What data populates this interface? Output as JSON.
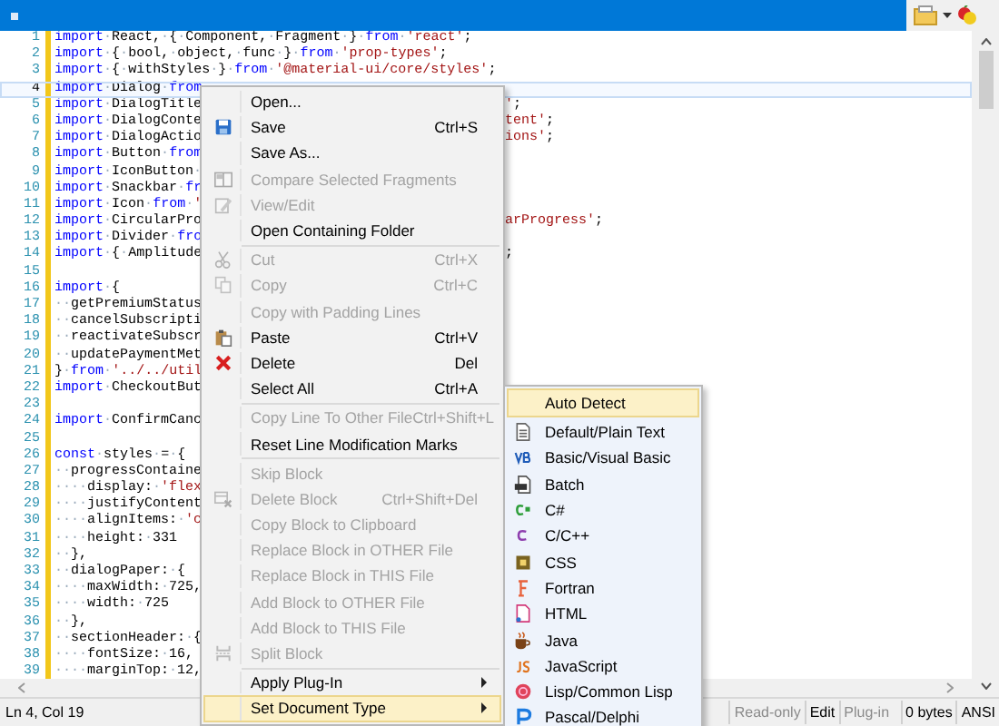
{
  "code_lines": [
    {
      "number": "1",
      "selected": false,
      "tokens": [
        {
          "kind": "keyword",
          "text": "import"
        },
        {
          "kind": "plain",
          "text": "·React,·{·Component,·Fragment·}·"
        },
        {
          "kind": "keyword",
          "text": "from"
        },
        {
          "kind": "plain",
          "text": "·"
        },
        {
          "kind": "string",
          "text": "'react'"
        },
        {
          "kind": "plain",
          "text": ";"
        }
      ]
    },
    {
      "number": "2",
      "selected": false,
      "tokens": [
        {
          "kind": "keyword",
          "text": "import"
        },
        {
          "kind": "plain",
          "text": "·{·bool,·object,·func·}·"
        },
        {
          "kind": "keyword",
          "text": "from"
        },
        {
          "kind": "plain",
          "text": "·"
        },
        {
          "kind": "string",
          "text": "'prop-types'"
        },
        {
          "kind": "plain",
          "text": ";"
        }
      ]
    },
    {
      "number": "3",
      "selected": false,
      "tokens": [
        {
          "kind": "keyword",
          "text": "import"
        },
        {
          "kind": "plain",
          "text": "·{·withStyles·}·"
        },
        {
          "kind": "keyword",
          "text": "from"
        },
        {
          "kind": "plain",
          "text": "·"
        },
        {
          "kind": "string",
          "text": "'@material-ui/core/styles'"
        },
        {
          "kind": "plain",
          "text": ";"
        }
      ]
    },
    {
      "number": "4",
      "selected": true,
      "tokens": [
        {
          "kind": "keyword",
          "text": "import"
        },
        {
          "kind": "plain",
          "text": "·Dialog·"
        },
        {
          "kind": "keyword",
          "text": "from"
        }
      ]
    },
    {
      "number": "5",
      "selected": false,
      "tokens": [
        {
          "kind": "keyword",
          "text": "import"
        },
        {
          "kind": "plain",
          "text": "·DialogTitle"
        }
      ],
      "tail": [
        {
          "kind": "string",
          "text": "'"
        },
        {
          "kind": "plain",
          "text": ";"
        }
      ]
    },
    {
      "number": "6",
      "selected": false,
      "tokens": [
        {
          "kind": "keyword",
          "text": "import"
        },
        {
          "kind": "plain",
          "text": "·DialogConte"
        }
      ],
      "tail": [
        {
          "kind": "string",
          "text": "tent'"
        },
        {
          "kind": "plain",
          "text": ";"
        }
      ]
    },
    {
      "number": "7",
      "selected": false,
      "tokens": [
        {
          "kind": "keyword",
          "text": "import"
        },
        {
          "kind": "plain",
          "text": "·DialogActio"
        }
      ],
      "tail": [
        {
          "kind": "string",
          "text": "ions'"
        },
        {
          "kind": "plain",
          "text": ";"
        }
      ]
    },
    {
      "number": "8",
      "selected": false,
      "tokens": [
        {
          "kind": "keyword",
          "text": "import"
        },
        {
          "kind": "plain",
          "text": "·Button·"
        },
        {
          "kind": "keyword",
          "text": "from"
        }
      ]
    },
    {
      "number": "9",
      "selected": false,
      "tokens": [
        {
          "kind": "keyword",
          "text": "import"
        },
        {
          "kind": "plain",
          "text": "·IconButton·"
        }
      ]
    },
    {
      "number": "10",
      "selected": false,
      "tokens": [
        {
          "kind": "keyword",
          "text": "import"
        },
        {
          "kind": "plain",
          "text": "·Snackbar·"
        },
        {
          "kind": "keyword",
          "text": "fr"
        }
      ]
    },
    {
      "number": "11",
      "selected": false,
      "tokens": [
        {
          "kind": "keyword",
          "text": "import"
        },
        {
          "kind": "plain",
          "text": "·Icon·"
        },
        {
          "kind": "keyword",
          "text": "from"
        },
        {
          "kind": "plain",
          "text": "·"
        },
        {
          "kind": "string",
          "text": "'"
        }
      ]
    },
    {
      "number": "12",
      "selected": false,
      "tokens": [
        {
          "kind": "keyword",
          "text": "import"
        },
        {
          "kind": "plain",
          "text": "·CircularPro"
        }
      ],
      "tail": [
        {
          "kind": "string",
          "text": "arProgress'"
        },
        {
          "kind": "plain",
          "text": ";"
        }
      ]
    },
    {
      "number": "13",
      "selected": false,
      "tokens": [
        {
          "kind": "keyword",
          "text": "import"
        },
        {
          "kind": "plain",
          "text": "·Divider·"
        },
        {
          "kind": "keyword",
          "text": "fro"
        }
      ]
    },
    {
      "number": "14",
      "selected": false,
      "tokens": [
        {
          "kind": "keyword",
          "text": "import"
        },
        {
          "kind": "plain",
          "text": "·{·Amplitude"
        }
      ],
      "tail": [
        {
          "kind": "plain",
          "text": ";"
        }
      ]
    },
    {
      "number": "15",
      "selected": false
    },
    {
      "number": "16",
      "selected": false,
      "tokens": [
        {
          "kind": "keyword",
          "text": "import"
        },
        {
          "kind": "plain",
          "text": "·{"
        }
      ]
    },
    {
      "number": "17",
      "selected": false,
      "tokens": [
        {
          "kind": "plain",
          "text": "··getPremiumStatus"
        }
      ]
    },
    {
      "number": "18",
      "selected": false,
      "tokens": [
        {
          "kind": "plain",
          "text": "··cancelSubscripti"
        }
      ]
    },
    {
      "number": "19",
      "selected": false,
      "tokens": [
        {
          "kind": "plain",
          "text": "··reactivateSubscr"
        }
      ]
    },
    {
      "number": "20",
      "selected": false,
      "tokens": [
        {
          "kind": "plain",
          "text": "··updatePaymentMet"
        }
      ]
    },
    {
      "number": "21",
      "selected": false,
      "tokens": [
        {
          "kind": "plain",
          "text": "}·"
        },
        {
          "kind": "keyword",
          "text": "from"
        },
        {
          "kind": "plain",
          "text": "·"
        },
        {
          "kind": "string",
          "text": "'../../util"
        }
      ]
    },
    {
      "number": "22",
      "selected": false,
      "tokens": [
        {
          "kind": "keyword",
          "text": "import"
        },
        {
          "kind": "plain",
          "text": "·CheckoutBut"
        }
      ]
    },
    {
      "number": "23",
      "selected": false
    },
    {
      "number": "24",
      "selected": false,
      "tokens": [
        {
          "kind": "keyword",
          "text": "import"
        },
        {
          "kind": "plain",
          "text": "·ConfirmCanc"
        }
      ]
    },
    {
      "number": "25",
      "selected": false
    },
    {
      "number": "26",
      "selected": false,
      "tokens": [
        {
          "kind": "keyword",
          "text": "const"
        },
        {
          "kind": "plain",
          "text": "·styles·=·{"
        }
      ]
    },
    {
      "number": "27",
      "selected": false,
      "tokens": [
        {
          "kind": "plain",
          "text": "··progressContaine"
        }
      ]
    },
    {
      "number": "28",
      "selected": false,
      "tokens": [
        {
          "kind": "plain",
          "text": "····display:·"
        },
        {
          "kind": "string",
          "text": "'flex"
        }
      ]
    },
    {
      "number": "29",
      "selected": false,
      "tokens": [
        {
          "kind": "plain",
          "text": "····justifyContent"
        }
      ]
    },
    {
      "number": "30",
      "selected": false,
      "tokens": [
        {
          "kind": "plain",
          "text": "····alignItems:·"
        },
        {
          "kind": "string",
          "text": "'c"
        }
      ]
    },
    {
      "number": "31",
      "selected": false,
      "tokens": [
        {
          "kind": "plain",
          "text": "····height:·331"
        }
      ]
    },
    {
      "number": "32",
      "selected": false,
      "tokens": [
        {
          "kind": "plain",
          "text": "··},"
        }
      ]
    },
    {
      "number": "33",
      "selected": false,
      "tokens": [
        {
          "kind": "plain",
          "text": "··dialogPaper:·{"
        }
      ]
    },
    {
      "number": "34",
      "selected": false,
      "tokens": [
        {
          "kind": "plain",
          "text": "····maxWidth:·725,"
        }
      ]
    },
    {
      "number": "35",
      "selected": false,
      "tokens": [
        {
          "kind": "plain",
          "text": "····width:·725"
        }
      ]
    },
    {
      "number": "36",
      "selected": false,
      "tokens": [
        {
          "kind": "plain",
          "text": "··},"
        }
      ]
    },
    {
      "number": "37",
      "selected": false,
      "tokens": [
        {
          "kind": "plain",
          "text": "··sectionHeader:·{"
        }
      ]
    },
    {
      "number": "38",
      "selected": false,
      "tokens": [
        {
          "kind": "plain",
          "text": "····fontSize:·16,"
        }
      ]
    },
    {
      "number": "39",
      "selected": false,
      "tokens": [
        {
          "kind": "plain",
          "text": "····marginTop:·12,"
        }
      ]
    }
  ],
  "context_menu": {
    "items": [
      {
        "kind": "item",
        "label": "Open...",
        "disabled": false,
        "selected": false
      },
      {
        "kind": "item",
        "label": "Save",
        "shortcut": "Ctrl+S",
        "disabled": false,
        "selected": false
      },
      {
        "kind": "item",
        "label": "Save As...",
        "disabled": false,
        "selected": false
      },
      {
        "kind": "item",
        "label": "Compare Selected Fragments",
        "disabled": true,
        "selected": false
      },
      {
        "kind": "item",
        "label": "View/Edit",
        "disabled": true,
        "selected": false
      },
      {
        "kind": "item",
        "label": "Open Containing Folder",
        "disabled": false,
        "selected": false
      },
      {
        "kind": "separator"
      },
      {
        "kind": "item",
        "label": "Cut",
        "shortcut": "Ctrl+X",
        "disabled": true,
        "selected": false
      },
      {
        "kind": "item",
        "label": "Copy",
        "shortcut": "Ctrl+C",
        "disabled": true,
        "selected": false
      },
      {
        "kind": "item",
        "label": "Copy with Padding Lines",
        "disabled": true,
        "selected": false
      },
      {
        "kind": "item",
        "label": "Paste",
        "shortcut": "Ctrl+V",
        "disabled": false,
        "selected": false
      },
      {
        "kind": "item",
        "label": "Delete",
        "shortcut": "Del",
        "disabled": false,
        "selected": false
      },
      {
        "kind": "item",
        "label": "Select All",
        "shortcut": "Ctrl+A",
        "disabled": false,
        "selected": false
      },
      {
        "kind": "separator"
      },
      {
        "kind": "item",
        "label": "Copy Line To Other File",
        "shortcut": "Ctrl+Shift+L",
        "disabled": true,
        "selected": false
      },
      {
        "kind": "item",
        "label": "Reset Line Modification Marks",
        "disabled": false,
        "selected": false
      },
      {
        "kind": "separator"
      },
      {
        "kind": "item",
        "label": "Skip Block",
        "disabled": true,
        "selected": false
      },
      {
        "kind": "item",
        "label": "Delete Block",
        "shortcut": "Ctrl+Shift+Del",
        "disabled": true,
        "selected": false
      },
      {
        "kind": "item",
        "label": "Copy Block to Clipboard",
        "disabled": true,
        "selected": false
      },
      {
        "kind": "item",
        "label": "Replace Block in OTHER File",
        "disabled": true,
        "selected": false
      },
      {
        "kind": "item",
        "label": "Replace Block in THIS File",
        "disabled": true,
        "selected": false
      },
      {
        "kind": "item",
        "label": "Add Block to OTHER File",
        "disabled": true,
        "selected": false
      },
      {
        "kind": "item",
        "label": "Add Block to THIS File",
        "disabled": true,
        "selected": false
      },
      {
        "kind": "item",
        "label": "Split Block",
        "disabled": true,
        "selected": false
      },
      {
        "kind": "separator"
      },
      {
        "kind": "submenu",
        "label": "Apply Plug-In",
        "disabled": false,
        "selected": false
      },
      {
        "kind": "submenu",
        "label": "Set Document Type",
        "disabled": false,
        "selected": true
      }
    ]
  },
  "document_type_menu": {
    "items": [
      {
        "label": "Auto Detect",
        "selected": true
      },
      {
        "label": "Default/Plain Text",
        "selected": false
      },
      {
        "label": "Basic/Visual Basic",
        "selected": false
      },
      {
        "label": "Batch",
        "selected": false
      },
      {
        "label": "C#",
        "selected": false
      },
      {
        "label": "C/C++",
        "selected": false
      },
      {
        "label": "CSS",
        "selected": false
      },
      {
        "label": "Fortran",
        "selected": false
      },
      {
        "label": "HTML",
        "selected": false
      },
      {
        "label": "Java",
        "selected": false
      },
      {
        "label": "JavaScript",
        "selected": false
      },
      {
        "label": "Lisp/Common Lisp",
        "selected": false
      },
      {
        "label": "Pascal/Delphi",
        "selected": false
      }
    ]
  },
  "status_bar": {
    "position": "Ln 4, Col 19",
    "mode_fields": [
      {
        "text": "Read-only",
        "disabled": true
      },
      {
        "text": "Edit",
        "disabled": false
      },
      {
        "text": "Plug-in",
        "disabled": true
      }
    ],
    "info_fields": [
      {
        "text": "0 bytes"
      },
      {
        "text": "ANSI"
      }
    ]
  }
}
